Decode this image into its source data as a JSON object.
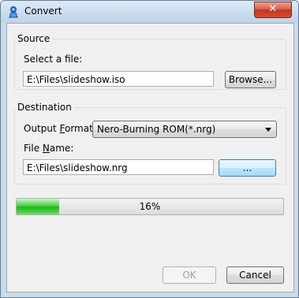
{
  "window": {
    "title": "Convert",
    "close_label": "✕"
  },
  "source": {
    "group_title": "Source",
    "select_label": "Select a file:",
    "file_path": "E:\\Files\\slideshow.iso",
    "browse_label": "Browse..."
  },
  "destination": {
    "group_title": "Destination",
    "format_label_pre": "Output ",
    "format_label_key": "F",
    "format_label_post": "ormat:",
    "format_value": "Nero-Burning ROM(*.nrg)",
    "filename_label_pre": "File ",
    "filename_label_key": "N",
    "filename_label_post": "ame:",
    "file_path": "E:\\Files\\slideshow.nrg",
    "browse_label": "..."
  },
  "progress": {
    "percent": 16,
    "text": "16%"
  },
  "footer": {
    "ok_label": "OK",
    "cancel_label": "Cancel"
  },
  "colors": {
    "progress_fill": "#18b814",
    "close_button": "#c4351d"
  }
}
